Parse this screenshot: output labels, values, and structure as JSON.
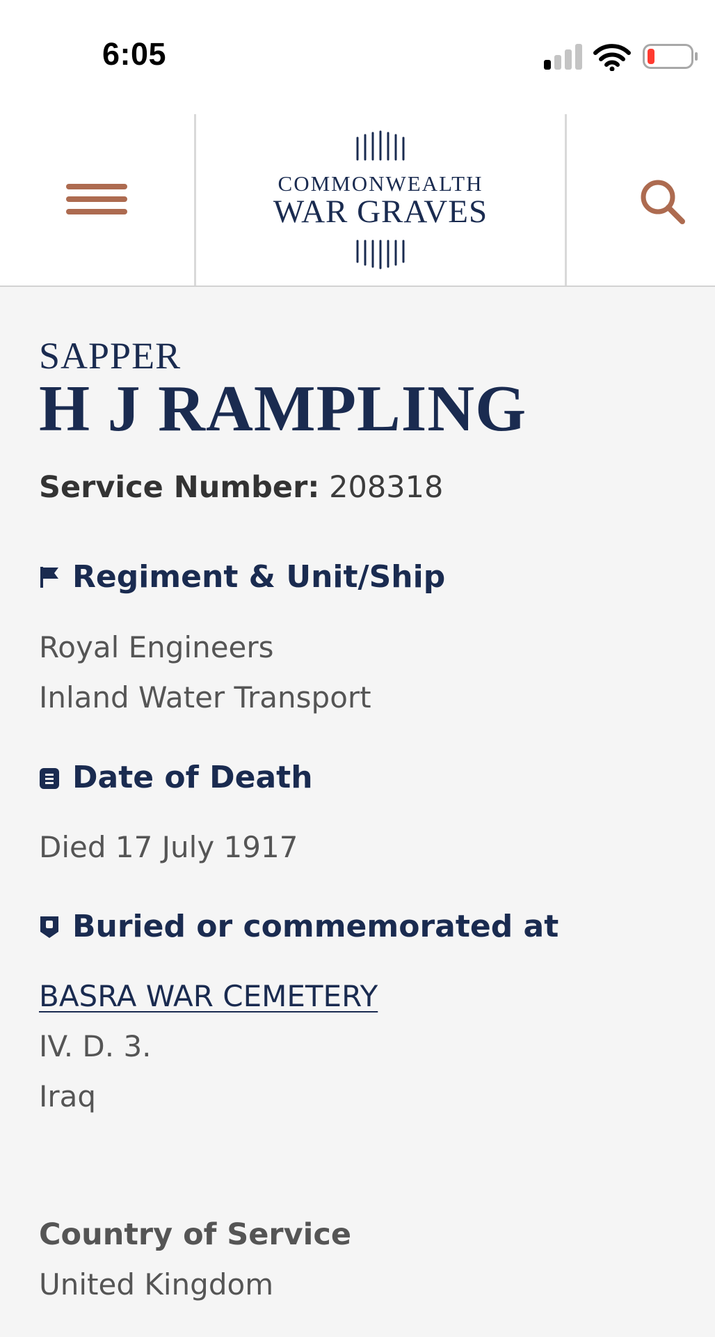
{
  "status_bar": {
    "time": "6:05",
    "icons": [
      "cellular-signal-icon",
      "wifi-icon",
      "battery-low-icon"
    ],
    "battery_color": "#ff3b30"
  },
  "header": {
    "logo_line1": "COMMONWEALTH",
    "logo_line2": "WAR GRAVES",
    "menu_icon": "hamburger-menu-icon",
    "search_icon": "search-icon",
    "accent_color": "#ad6b50",
    "brand_color": "#1a2b50"
  },
  "person": {
    "rank": "SAPPER",
    "name": "H J RAMPLING",
    "service_number_label": "Service Number:",
    "service_number": "208318"
  },
  "sections": {
    "regiment": {
      "icon": "flag-icon",
      "heading": "Regiment & Unit/Ship",
      "lines": [
        "Royal Engineers",
        "Inland Water Transport"
      ]
    },
    "death": {
      "icon": "calendar-icon",
      "heading": "Date of Death",
      "value": "Died 17 July 1917"
    },
    "burial": {
      "icon": "map-marker-icon",
      "heading": "Buried or commemorated at",
      "cemetery": "BASRA WAR CEMETERY",
      "plot": "IV. D. 3.",
      "country": "Iraq"
    },
    "country_of_service": {
      "heading": "Country of Service",
      "value": "United Kingdom"
    }
  }
}
